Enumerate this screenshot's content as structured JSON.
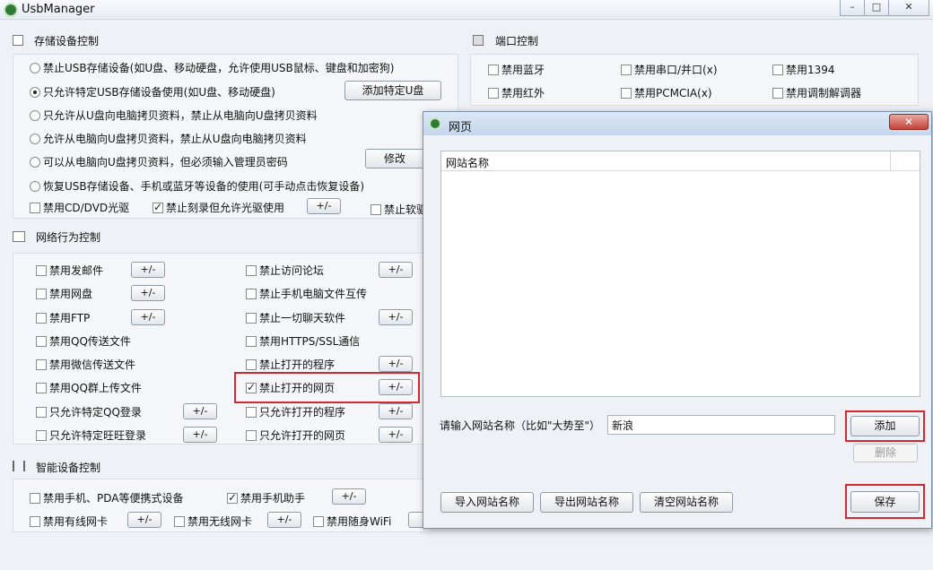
{
  "window": {
    "title": "UsbManager"
  },
  "storage": {
    "title": "存储设备控制",
    "radios": [
      "禁止USB存储设备(如U盘、移动硬盘，允许使用USB鼠标、键盘和加密狗)",
      "只允许特定USB存储设备使用(如U盘、移动硬盘)",
      "只允许从U盘向电脑拷贝资料，禁止从电脑向U盘拷贝资料",
      "允许从电脑向U盘拷贝资料，禁止从U盘向电脑拷贝资料",
      "可以从电脑向U盘拷贝资料，但必须输入管理员密码",
      "恢复USB存储设备、手机或蓝牙等设备的使用(可手动点击恢复设备)"
    ],
    "add_specific_btn": "添加特定U盘",
    "modify_btn": "修改",
    "cd_disable": "禁用CD/DVD光驱",
    "no_burn": "禁止刻录但允许光驱使用",
    "pm": "+/-",
    "soft_partial": "禁止软驱"
  },
  "port": {
    "title": "端口控制",
    "items": [
      "禁用蓝牙",
      "禁用串口/并口(x)",
      "禁用1394",
      "禁用红外",
      "禁用PCMCIA(x)",
      "禁用调制解调器"
    ]
  },
  "network": {
    "title": "网络行为控制",
    "left": [
      "禁用发邮件",
      "禁用网盘",
      "禁用FTP",
      "禁用QQ传送文件",
      "禁用微信传送文件",
      "禁用QQ群上传文件",
      "只允许特定QQ登录",
      "只允许特定旺旺登录"
    ],
    "right": [
      "禁止访问论坛",
      "禁止手机电脑文件互传",
      "禁止一切聊天软件",
      "禁用HTTPS/SSL通信",
      "禁止打开的程序",
      "禁止打开的网页",
      "只允许打开的程序",
      "只允许打开的网页"
    ]
  },
  "smart": {
    "title": "智能设备控制",
    "items": [
      "禁用手机、PDA等便携式设备",
      "禁用手机助手",
      "禁用有线网卡",
      "禁用无线网卡",
      "禁用随身WiFi"
    ]
  },
  "dialog": {
    "title": "网页",
    "close": "✕",
    "column_header": "网站名称",
    "input_label": "请输入网站名称（比如\"大势至\"）",
    "input_value": "新浪",
    "add_btn": "添加",
    "delete_btn": "删除",
    "import_btn": "导入网站名称",
    "export_btn": "导出网站名称",
    "clear_btn": "清空网站名称",
    "save_btn": "保存"
  },
  "icons": {
    "storage": "storage-icon",
    "port": "port-icon",
    "network": "network-icon",
    "smart": "smart-icon"
  }
}
